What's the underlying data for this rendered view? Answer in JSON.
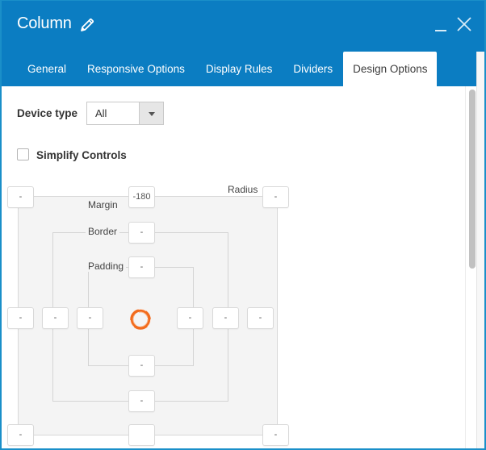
{
  "window": {
    "title": "Column",
    "title_icon": "pencil-icon",
    "controls": {
      "minimize": "minimize-icon",
      "close": "close-icon"
    }
  },
  "tabs": [
    {
      "label": "General",
      "active": false
    },
    {
      "label": "Responsive Options",
      "active": false
    },
    {
      "label": "Display Rules",
      "active": false
    },
    {
      "label": "Dividers",
      "active": false
    },
    {
      "label": "Design Options",
      "active": true
    }
  ],
  "device_type": {
    "label": "Device type",
    "selected": "All"
  },
  "simplify_controls": {
    "label": "Simplify Controls",
    "checked": false
  },
  "box_model": {
    "labels": {
      "margin": "Margin",
      "border": "Border",
      "padding": "Padding",
      "radius": "Radius"
    },
    "radius": {
      "top_left": "-",
      "top_right": "-",
      "bottom_left": "-",
      "bottom_right": "-"
    },
    "margin": {
      "top": "-180",
      "right": "-",
      "bottom": "",
      "left": "-"
    },
    "border": {
      "top": "-",
      "right": "-",
      "bottom": "-",
      "left": "-"
    },
    "padding": {
      "top": "-",
      "right": "-",
      "bottom": "-",
      "left": "-"
    },
    "center_icon": "loading-spinner-icon"
  },
  "colors": {
    "header": "#0b7dc2",
    "spinner": "#f26b1d"
  }
}
